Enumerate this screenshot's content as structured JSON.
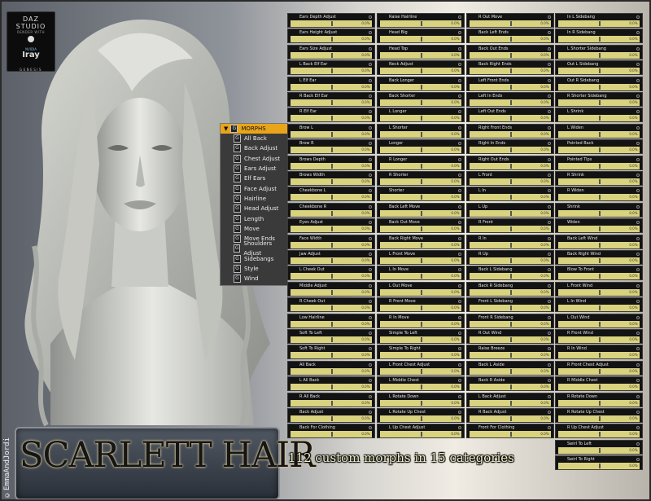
{
  "branding": {
    "line1": "DAZ STUDIO",
    "line2": "RENDER WITH",
    "line3": "NVIDIA",
    "line4": "Iray",
    "line5": "GENESIS"
  },
  "credit": "©EmmaAndJordi",
  "title": "SCARLETT HAIR",
  "tagline": "112 custom morphs in 15 categories",
  "menu": {
    "header": "MORPHS",
    "group_glyph": "G",
    "items": [
      "All Back",
      "Back Adjust",
      "Chest Adjust",
      "Ears Adjust",
      "Elf Ears",
      "Face Adjust",
      "Hairline",
      "Head Adjust",
      "Length",
      "Move",
      "Move Ends",
      "Shoulders Adjust",
      "Sidebangs",
      "Style",
      "Wind"
    ]
  },
  "slider_default_value": "0.0%",
  "columns": [
    [
      "Ears Depth Adjust",
      "Ears Height Adjust",
      "Ears Size Adjust",
      "L Back Elf Ear",
      "L Elf Ear",
      "R Back Elf Ear",
      "R Elf Ear",
      "Brow L",
      "Brow R",
      "Brows Depth",
      "Brows Width",
      "Cheekbone L",
      "Cheekbone R",
      "Eyes Adjust",
      "Face Width",
      "Jaw Adjust",
      "L Cheek Out",
      "Middle Adjust",
      "R Cheek Out",
      "Low Hairline",
      "Soft To Left",
      "Soft To Right",
      "All Back",
      "L All Back",
      "R All Back",
      "Back Adjust",
      "Back For Clothing"
    ],
    [
      "Raise Hairline",
      "Head Big",
      "Head Top",
      "Neck Adjust",
      "Back Longer",
      "Back Shorter",
      "L Longer",
      "L Shorter",
      "Longer",
      "R Longer",
      "R Shorter",
      "Shorter",
      "Back Left Move",
      "Back Out Move",
      "Back Right Move",
      "L Front Move",
      "L In Move",
      "L Out Move",
      "R Front Move",
      "R In Move",
      "Simple To Left",
      "Simple To Right",
      "L Front Chest Adjust",
      "L Middle Chest",
      "L Rotate Down",
      "L Rotate Up Chest",
      "L Up Chest Adjust"
    ],
    [
      "R Out Move",
      "Back Left Ends",
      "Back Out Ends",
      "Back Right Ends",
      "Left Front Ends",
      "Left In Ends",
      "Left Out Ends",
      "Right Front Ends",
      "Right In Ends",
      "Right Out Ends",
      "L Front",
      "L In",
      "L Up",
      "R Front",
      "R In",
      "R Up",
      "Back L Sidebang",
      "Back R Sidebang",
      "Front L Sidebang",
      "Front R Sidebang",
      "R Out Wind",
      "Raise Breeze",
      "Back L Aside",
      "Back R Aside",
      "L Back Adjust",
      "R Back Adjust",
      "Front For Clothing"
    ],
    [
      "In L Sidebang",
      "In R Sidebang",
      "L Shorter Sidebang",
      "Out L Sidebang",
      "Out R Sidebang",
      "R Shorter Sidebang",
      "L Shrink",
      "L Widen",
      "Pointed Back",
      "Pointed Tips",
      "R Shrink",
      "R Widen",
      "Shrink",
      "Widen",
      "Back Left Wind",
      "Back Right Wind",
      "Blow To Front",
      "L Front Wind",
      "L In Wind",
      "L Out Wind",
      "R Front Wind",
      "R In Wind",
      "R Front Chest Adjust",
      "R Middle Chest",
      "R Rotate Down",
      "R Rotate Up Chest",
      "R Up Chest Adjust",
      "Swirl To Left",
      "Swirl To Right"
    ]
  ]
}
